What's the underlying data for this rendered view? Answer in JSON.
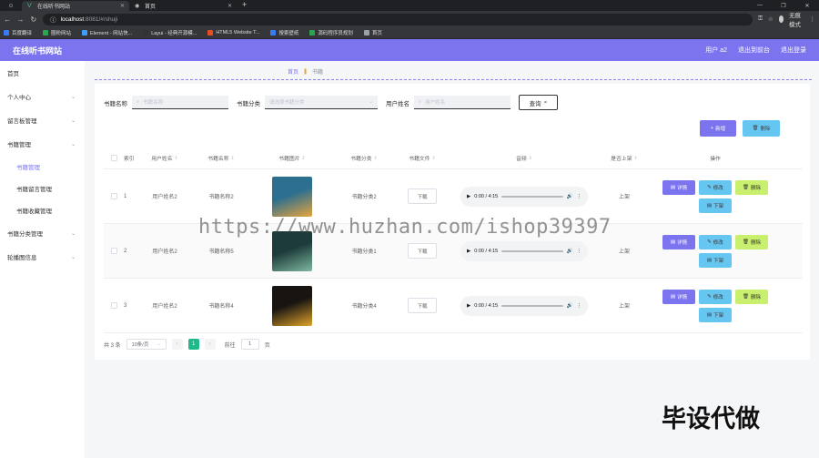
{
  "browser": {
    "tabs": [
      {
        "label": "在线听书网站",
        "active": true
      },
      {
        "label": "首页",
        "active": false
      }
    ],
    "url_host": "localhost",
    "url_path": ":8081/#/shuji",
    "profile_label": "无痕模式",
    "bookmarks": [
      {
        "label": "百度翻译",
        "color": "#3a7bf5"
      },
      {
        "label": "圈粉网站",
        "color": "#2ea44f"
      },
      {
        "label": "Element - 网站快...",
        "color": "#409eff"
      },
      {
        "label": "Layui - 经典开源模...",
        "color": "#333333"
      },
      {
        "label": "HTML5 Website T...",
        "color": "#e44d26"
      },
      {
        "label": "搜索壁纸",
        "color": "#3a7bf5"
      },
      {
        "label": "源码程序员规划",
        "color": "#2ea44f"
      },
      {
        "label": "首页",
        "color": "#9aa0a6"
      }
    ]
  },
  "header": {
    "title": "在线听书网站",
    "links": [
      "用户 a2",
      "退出到前台",
      "退出登录"
    ]
  },
  "sidebar": {
    "items": [
      {
        "label": "首页",
        "sub": false,
        "arrow": false
      },
      {
        "label": "个人中心",
        "sub": false,
        "arrow": true
      },
      {
        "label": "留言板管理",
        "sub": false,
        "arrow": true
      },
      {
        "label": "书籍管理",
        "sub": false,
        "arrow": true
      },
      {
        "label": "书籍管理",
        "sub": true,
        "active": true
      },
      {
        "label": "书籍留言管理",
        "sub": true
      },
      {
        "label": "书籍收藏管理",
        "sub": true
      },
      {
        "label": "书籍分类管理",
        "sub": false,
        "arrow": true
      },
      {
        "label": "轮播图信息",
        "sub": false,
        "arrow": true
      }
    ]
  },
  "breadcrumb": {
    "home": "首页",
    "current": "书籍"
  },
  "search": {
    "fields": [
      {
        "label": "书籍名称",
        "placeholder": "书籍名称"
      },
      {
        "label": "书籍分类",
        "placeholder": "请选择书籍分类"
      },
      {
        "label": "用户姓名",
        "placeholder": "用户姓名"
      }
    ],
    "query_label": "查询"
  },
  "actions": {
    "add_label": "新增",
    "delete_label": "删除"
  },
  "table": {
    "columns": [
      "索引",
      "用户姓名",
      "书籍名称",
      "书籍图片",
      "书籍分类",
      "书籍文件",
      "音频",
      "是否上架",
      "操作"
    ],
    "rows": [
      {
        "index": "1",
        "user": "用户姓名2",
        "book": "书籍名称2",
        "category": "书籍分类2",
        "file_label": "下载",
        "time": "0:00 / 4:15",
        "shelf": "上架",
        "cover_colors": [
          "#2d6f8f",
          "#e7a43c"
        ]
      },
      {
        "index": "2",
        "user": "用户姓名2",
        "book": "书籍名称5",
        "category": "书籍分类1",
        "file_label": "下载",
        "time": "0:00 / 4:15",
        "shelf": "上架",
        "cover_colors": [
          "#1d3b3a",
          "#7fb8a0"
        ]
      },
      {
        "index": "3",
        "user": "用户姓名2",
        "book": "书籍名称4",
        "category": "书籍分类4",
        "file_label": "下载",
        "time": "0:00 / 4:15",
        "shelf": "上架",
        "cover_colors": [
          "#171412",
          "#e0a32a"
        ]
      }
    ],
    "op_labels": {
      "detail": "详情",
      "edit": "修改",
      "remove": "删除",
      "download": "下架"
    }
  },
  "pagination": {
    "total": "共 3 条",
    "page_size": "10条/页",
    "current": "1",
    "goto_prefix": "前往",
    "goto_value": "1",
    "goto_suffix": "页"
  },
  "overlay": {
    "watermark": "https://www.huzhan.com/ishop39397",
    "stamp": "毕设代做"
  }
}
